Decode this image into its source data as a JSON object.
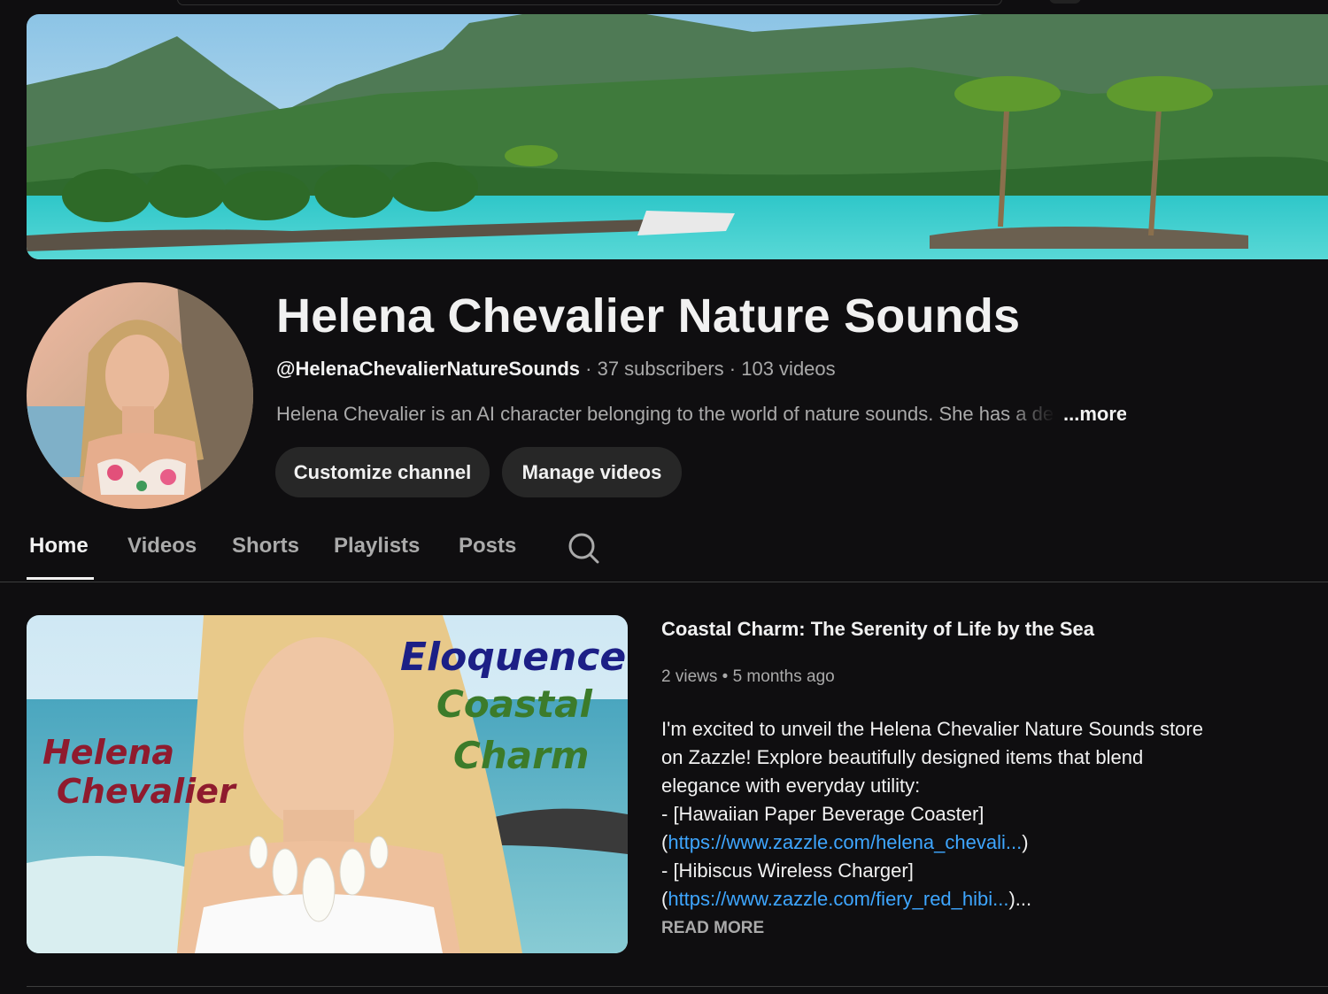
{
  "colors": {
    "background": "#0f0e10",
    "text": "#f1f1f1",
    "muted": "#aaaaaa",
    "button_bg": "#272727",
    "link": "#3ea6ff"
  },
  "banner": {
    "description_icon": "tropical-island-banner"
  },
  "channel": {
    "name": "Helena Chevalier Nature Sounds",
    "handle": "@HelenaChevalierNatureSounds",
    "subscribers": "37 subscribers",
    "videos": "103 videos",
    "separator": "·",
    "description": "Helena Chevalier is an AI character belonging to the world of nature sounds. She has a de",
    "more_label": "...more",
    "buttons": {
      "customize": "Customize channel",
      "manage": "Manage videos"
    }
  },
  "tabs": [
    {
      "label": "Home",
      "active": true
    },
    {
      "label": "Videos",
      "active": false
    },
    {
      "label": "Shorts",
      "active": false
    },
    {
      "label": "Playlists",
      "active": false
    },
    {
      "label": "Posts",
      "active": false
    }
  ],
  "featured": {
    "thumbnail": {
      "left_line1": "Helena",
      "left_line2": "Chevalier",
      "right_line1": "Eloquence",
      "right_line2": "Coastal",
      "right_line3": "Charm"
    },
    "title": "Coastal Charm: The Serenity of Life by the Sea",
    "views": "2 views",
    "dot": "•",
    "age": "5 months ago",
    "description": {
      "line1": "I'm excited to unveil the Helena Chevalier Nature Sounds store",
      "line2": "on Zazzle! Explore beautifully designed items that blend",
      "line3": "elegance with everyday utility:",
      "line4": "- [Hawaiian Paper Beverage Coaster]",
      "line5_open": "(",
      "line5_link": "https://www.zazzle.com/helena_chevali...",
      "line5_close": ")",
      "line6": "- [Hibiscus Wireless Charger]",
      "line7_open": "(",
      "line7_link": "https://www.zazzle.com/fiery_red_hibi...",
      "line7_close": ")..."
    },
    "read_more": "READ MORE"
  }
}
